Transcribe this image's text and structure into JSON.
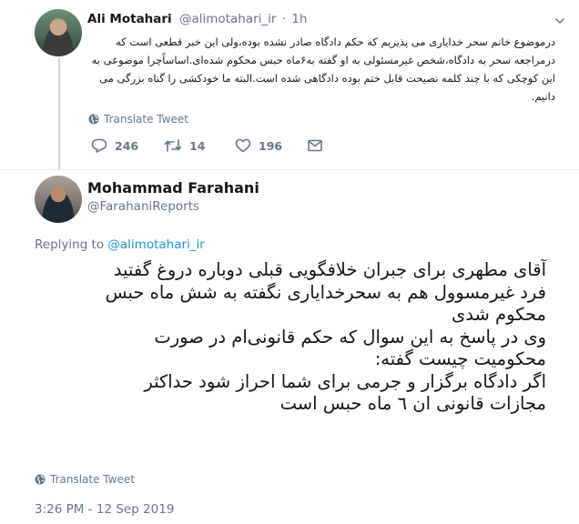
{
  "parent_tweet": {
    "author_name": "Ali Motahari",
    "author_handle": "@alimotahari_ir",
    "dot": "·",
    "time": "1h",
    "text": "درموضوع خانم سحر خدایاری می پذیریم که حکم دادگاه صادر نشده بوده،ولی این خبر قطعی است که درمراجعه سحر به دادگاه،شخص غیرمسئولی به او گفته به۶ماه حبس محکوم شده‌ای.اساساًچرا موضوعی به این کوچکی که با چند کلمه نصیحت قابل ختم بوده دادگاهی شده است.البته ما خودکشی را گناه بزرگی می دانیم.",
    "translate_label": "Translate Tweet",
    "reply_count": "246",
    "retweet_count": "14",
    "like_count": "196",
    "icons": [
      "caret-down-icon",
      "globe-icon",
      "reply-icon",
      "retweet-icon",
      "like-icon",
      "direct-message-icon"
    ]
  },
  "main_tweet": {
    "author_name": "Mohammad Farahani",
    "author_handle": "@FarahaniReports",
    "replying_prefix": "Replying to",
    "replying_handle": "@alimotahari_ir",
    "lines": [
      "آقای مطهری برای جبران خلافگویی قبلی دوباره دروغ گفتید",
      "فرد غیرمسوول هم به سحرخدایاری نگفته به شش ماه حبس",
      "محکوم شدی",
      "وی در پاسخ به این سوال که حکم قانونی‌ام در صورت",
      "محکومیت چیست گفته:",
      "اگر دادگاه برگزار و جرمی برای شما احراز شود حداکثر",
      "مجازات قانونی ان ٦ ماه حبس است"
    ],
    "translate_label": "Translate Tweet",
    "timestamp": "3:26 PM - 12 Sep 2019"
  },
  "colors": {
    "text": "#14171a",
    "secondary": "#657786",
    "link": "#1b95e0",
    "thread_line": "#ccd6dd"
  }
}
